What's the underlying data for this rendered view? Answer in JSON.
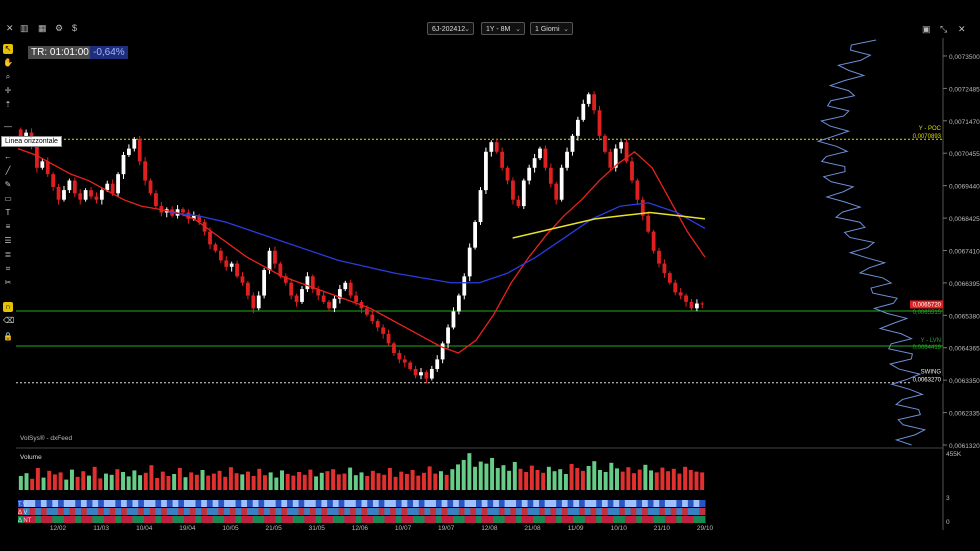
{
  "toolbar": {
    "close_icon": "close-icon",
    "symbol": "6J-202412",
    "range": "1Y - 8M",
    "interval": "1 Giorni"
  },
  "overlay": {
    "tr_label": "TR: 01:01:00",
    "pct_label": "-0,64%",
    "tooltip": "Linea orizzontale",
    "credits": "VolSys® - dxFeed",
    "volume_label": "Volume",
    "volume_axis_top": "455K",
    "strip_labels": [
      "T.V",
      "Δ V",
      "Δ NT"
    ],
    "strip_axis": [
      "3",
      "0"
    ]
  },
  "levels": {
    "poc_label": "Y - POC",
    "poc_value": "0,0070893",
    "lvn1_label": "Y - LVN",
    "lvn1_value": "0,0065515",
    "lvn2_label": "Y - LVN",
    "lvn2_value": "0,0064419",
    "swing_label": "SWING",
    "swing_value": "0,0063270",
    "last_value": "0,0065720"
  },
  "colors": {
    "bull": "#ffffff",
    "bear": "#e02020",
    "ema_fast": "#e8231d",
    "ema_slow": "#2b3be0",
    "vwap": "#e8e02a",
    "poc_line": "#dddd00",
    "lvn_line": "#22aa22",
    "swing_line": "#dddddd",
    "profile": "#6f8fd8"
  },
  "chart_data": {
    "type": "candlestick",
    "title": "6J-202412",
    "yaxis_ticks": [
      "0,0073500",
      "0,0072485",
      "0,0071470",
      "0,0070455",
      "0,0069440",
      "0,0068425",
      "0,0067410",
      "0,0066395",
      "0,0065380",
      "0,0064365",
      "0,0063350",
      "0,0062335",
      "0,0061320"
    ],
    "ylim": [
      0.006132,
      0.0074
    ],
    "xaxis_ticks": [
      "12/02",
      "11/03",
      "10/04",
      "19/04",
      "10/05",
      "21/05",
      "31/05",
      "12/06",
      "10/07",
      "19/07",
      "12/08",
      "21/08",
      "11/09",
      "10/10",
      "21/10",
      "29/10"
    ],
    "close": [
      0.00709,
      0.00711,
      0.00707,
      0.007,
      0.00702,
      0.00698,
      0.00694,
      0.0069,
      0.00693,
      0.00696,
      0.00692,
      0.0069,
      0.00693,
      0.00691,
      0.0069,
      0.00693,
      0.00695,
      0.00692,
      0.00698,
      0.00704,
      0.00706,
      0.00709,
      0.00702,
      0.00696,
      0.00692,
      0.00688,
      0.00686,
      0.00687,
      0.00685,
      0.00687,
      0.00686,
      0.00684,
      0.00685,
      0.00683,
      0.0068,
      0.00676,
      0.00674,
      0.00671,
      0.00669,
      0.0067,
      0.00666,
      0.00664,
      0.0066,
      0.00656,
      0.0066,
      0.00668,
      0.00674,
      0.0067,
      0.00666,
      0.00664,
      0.0066,
      0.00658,
      0.00662,
      0.00666,
      0.00662,
      0.0066,
      0.00658,
      0.00656,
      0.00659,
      0.00662,
      0.00664,
      0.0066,
      0.00658,
      0.00656,
      0.00654,
      0.00652,
      0.0065,
      0.00648,
      0.00645,
      0.00642,
      0.0064,
      0.00639,
      0.00637,
      0.00635,
      0.00636,
      0.00634,
      0.00637,
      0.0064,
      0.00645,
      0.0065,
      0.00655,
      0.0066,
      0.00666,
      0.00675,
      0.00683,
      0.00693,
      0.00705,
      0.00708,
      0.00705,
      0.007,
      0.00696,
      0.0069,
      0.00688,
      0.00696,
      0.007,
      0.00703,
      0.00706,
      0.007,
      0.00695,
      0.0069,
      0.007,
      0.00705,
      0.0071,
      0.00715,
      0.0072,
      0.00723,
      0.00718,
      0.0071,
      0.00705,
      0.007,
      0.00706,
      0.00708,
      0.00702,
      0.00696,
      0.0069,
      0.00685,
      0.0068,
      0.00674,
      0.0067,
      0.00667,
      0.00664,
      0.00661,
      0.0066,
      0.00658,
      0.00656,
      0.006575,
      0.006572
    ],
    "ema_fast": [
      0.00706,
      0.00704,
      0.00701,
      0.00698,
      0.00696,
      0.00693,
      0.0069,
      0.00688,
      0.00687,
      0.00686,
      0.00684,
      0.0068,
      0.00676,
      0.00672,
      0.00669,
      0.00666,
      0.00664,
      0.00662,
      0.0066,
      0.00658,
      0.00656,
      0.00653,
      0.0065,
      0.00647,
      0.00644,
      0.00642,
      0.00646,
      0.00654,
      0.00664,
      0.00672,
      0.00679,
      0.00685,
      0.0069,
      0.00696,
      0.00701,
      0.00705,
      0.007,
      0.0069,
      0.0068,
      0.00672
    ],
    "ema_slow": [
      0.00686,
      0.00685,
      0.00683,
      0.0068,
      0.00677,
      0.00674,
      0.00671,
      0.00669,
      0.00667,
      0.006655,
      0.00664,
      0.00664,
      0.00667,
      0.00672,
      0.00678,
      0.00684,
      0.00688,
      0.00689,
      0.00686,
      0.00681
    ],
    "vwap": [
      0.00678,
      0.0068,
      0.00682,
      0.00684,
      0.00685,
      0.00686,
      0.00685,
      0.00684
    ],
    "volume": [
      0.35,
      0.42,
      0.28,
      0.55,
      0.31,
      0.48,
      0.39,
      0.44,
      0.26,
      0.51,
      0.33,
      0.47,
      0.36,
      0.58,
      0.29,
      0.41,
      0.38,
      0.52,
      0.45,
      0.34,
      0.49,
      0.37,
      0.43,
      0.62,
      0.3,
      0.46,
      0.35,
      0.4,
      0.55,
      0.32,
      0.44,
      0.38,
      0.5,
      0.36,
      0.41,
      0.48,
      0.33,
      0.57,
      0.42,
      0.39,
      0.46,
      0.35,
      0.53,
      0.37,
      0.44,
      0.31,
      0.49,
      0.4,
      0.36,
      0.45,
      0.38,
      0.51,
      0.34,
      0.43,
      0.47,
      0.52,
      0.39,
      0.41,
      0.56,
      0.37,
      0.44,
      0.35,
      0.48,
      0.42,
      0.38,
      0.55,
      0.33,
      0.46,
      0.4,
      0.5,
      0.36,
      0.43,
      0.59,
      0.41,
      0.47,
      0.38,
      0.52,
      0.64,
      0.75,
      0.92,
      0.58,
      0.71,
      0.66,
      0.8,
      0.55,
      0.62,
      0.48,
      0.7,
      0.53,
      0.45,
      0.61,
      0.5,
      0.43,
      0.58,
      0.47,
      0.52,
      0.4,
      0.65,
      0.55,
      0.48,
      0.6,
      0.72,
      0.5,
      0.45,
      0.68,
      0.54,
      0.46,
      0.57,
      0.42,
      0.51,
      0.63,
      0.49,
      0.44,
      0.56,
      0.47,
      0.53,
      0.41,
      0.58,
      0.5,
      0.46,
      0.44
    ]
  }
}
